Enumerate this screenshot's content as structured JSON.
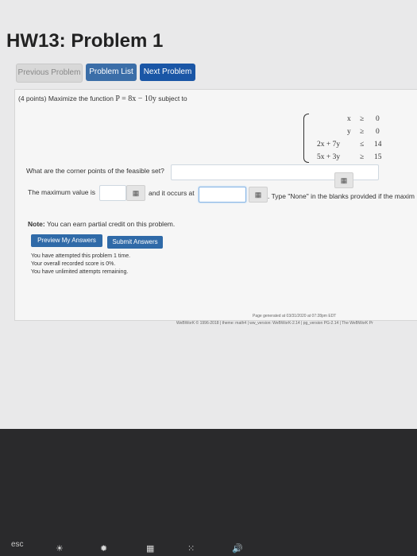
{
  "page": {
    "title": "HW13: Problem 1",
    "nav": {
      "previous": "Previous Problem",
      "list": "Problem List",
      "next": "Next Problem"
    },
    "problem": {
      "points": "(4 points)",
      "statement": "Maximize the function",
      "function": "P = 8x − 10y",
      "subject_to": "subject to",
      "constraints": [
        {
          "lhs": "x",
          "op": "≥",
          "rhs": "0"
        },
        {
          "lhs": "y",
          "op": "≥",
          "rhs": "0"
        },
        {
          "lhs": "2x + 7y",
          "op": "≤",
          "rhs": "14"
        },
        {
          "lhs": "5x + 3y",
          "op": "≥",
          "rhs": "15"
        }
      ],
      "corner_question": "What are the corner points of the feasible set?",
      "max_label": "The maximum value is",
      "occurs_label": "and it occurs at",
      "none_hint": ". Type \"None\" in the blanks provided if the maxim",
      "grid_icon_glyph": "▦",
      "note_bold": "Note:",
      "note": "You can earn partial credit on this problem.",
      "preview_button": "Preview My Answers",
      "submit_button": "Submit Answers",
      "status_lines": [
        "You have attempted this problem 1 time.",
        "Your overall recorded score is 0%.",
        "You have unlimited attempts remaining."
      ]
    },
    "footer": {
      "generated": "Page generated at 03/31/2020 at 07:28pm EDT",
      "credits": "WeBWorK © 1996-2018 | theme: math4 | ww_version: WeBWorK-2.14 | pg_version PG-2.14 | The WeBWorK Pr"
    }
  },
  "keyboard": {
    "esc": "esc"
  }
}
